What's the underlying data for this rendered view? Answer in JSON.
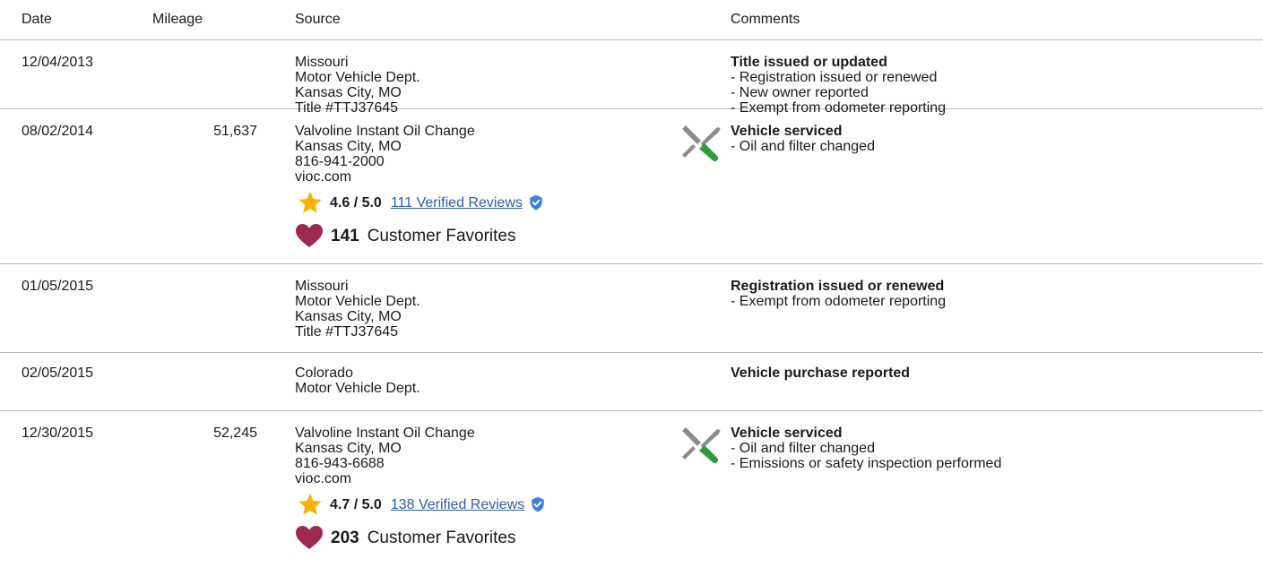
{
  "headers": {
    "date": "Date",
    "mileage": "Mileage",
    "source": "Source",
    "comments": "Comments"
  },
  "icons": {
    "service": "wrench-screwdriver-icon",
    "star": "star-icon",
    "heart": "heart-icon",
    "verified": "verified-check-icon"
  },
  "colors": {
    "star": "#f4b400",
    "heart": "#9e2a4d",
    "link": "#2a5fa8",
    "verified": "#3b82e0"
  },
  "rows": [
    {
      "date": "12/04/2013",
      "mileage": "",
      "source": [
        "Missouri",
        "Motor Vehicle Dept.",
        "Kansas City, MO",
        "Title #TTJ37645"
      ],
      "comment_title": "Title issued or updated",
      "comment_lines": [
        "- Registration issued or renewed",
        "- New owner reported",
        "- Exempt from odometer reporting"
      ]
    },
    {
      "date": "08/02/2014",
      "mileage": "51,637",
      "source": [
        "Valvoline Instant Oil Change",
        "Kansas City, MO",
        "816-941-2000",
        "vioc.com"
      ],
      "rating": "4.6 / 5.0",
      "reviews": "111 Verified Reviews",
      "favorites": "141",
      "favorites_label": "Customer Favorites",
      "comment_title": "Vehicle serviced",
      "comment_lines": [
        "- Oil and filter changed"
      ]
    },
    {
      "date": "01/05/2015",
      "mileage": "",
      "source": [
        "Missouri",
        "Motor Vehicle Dept.",
        "Kansas City, MO",
        "Title #TTJ37645"
      ],
      "comment_title": "Registration issued or renewed",
      "comment_lines": [
        "- Exempt from odometer reporting"
      ]
    },
    {
      "date": "02/05/2015",
      "mileage": "",
      "source": [
        "Colorado",
        "Motor Vehicle Dept."
      ],
      "comment_title": "Vehicle purchase reported",
      "comment_lines": []
    },
    {
      "date": "12/30/2015",
      "mileage": "52,245",
      "source": [
        "Valvoline Instant Oil Change",
        "Kansas City, MO",
        "816-943-6688",
        "vioc.com"
      ],
      "rating": "4.7 / 5.0",
      "reviews": "138 Verified Reviews",
      "favorites": "203",
      "favorites_label": "Customer Favorites",
      "comment_title": "Vehicle serviced",
      "comment_lines": [
        "- Oil and filter changed",
        "- Emissions or safety inspection performed"
      ]
    }
  ]
}
